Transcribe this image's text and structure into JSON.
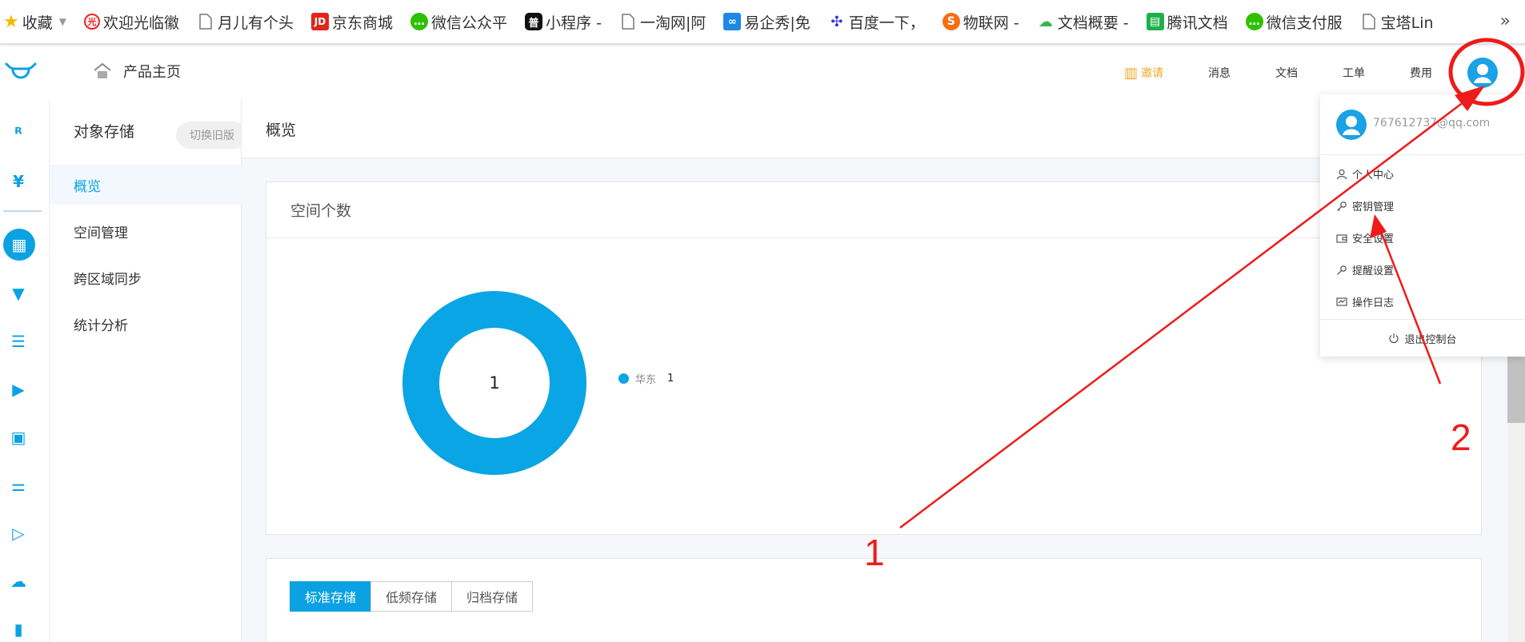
{
  "bookmarks": {
    "items": [
      {
        "label": "收藏",
        "icon": "star-icon"
      },
      {
        "label": "欢迎光临徽",
        "icon": "site-icon"
      },
      {
        "label": "月儿有个头",
        "icon": "page-icon"
      },
      {
        "label": "京东商城",
        "icon": "jd-icon"
      },
      {
        "label": "微信公众平",
        "icon": "wechat-icon"
      },
      {
        "label": "小程序 -",
        "icon": "miniprogram-icon"
      },
      {
        "label": "一淘网|阿",
        "icon": "page-icon"
      },
      {
        "label": "易企秀|免",
        "icon": "eqxiu-icon"
      },
      {
        "label": "百度一下，",
        "icon": "baidu-icon"
      },
      {
        "label": "物联网 -",
        "icon": "sohu-icon"
      },
      {
        "label": "文档概要 -",
        "icon": "cloud-icon"
      },
      {
        "label": "腾讯文档",
        "icon": "sheet-icon"
      },
      {
        "label": "微信支付服",
        "icon": "wechat-icon"
      },
      {
        "label": "宝塔Lin",
        "icon": "page-icon"
      }
    ],
    "more": "»"
  },
  "header": {
    "home_label": "产品主页",
    "nav": {
      "invite": "邀请",
      "messages": "消息",
      "docs": "文档",
      "tickets": "工单",
      "billing": "费用"
    }
  },
  "sidebar": {
    "title": "对象存储",
    "switch_old": "切换旧版",
    "items": [
      {
        "label": "概览",
        "active": true
      },
      {
        "label": "空间管理",
        "active": false
      },
      {
        "label": "跨区域同步",
        "active": false
      },
      {
        "label": "统计分析",
        "active": false
      }
    ]
  },
  "main": {
    "page_title": "概览",
    "space_card": {
      "title": "空间个数",
      "legend_name": "华东",
      "legend_value": "1"
    },
    "storage_tabs": [
      "标准存储",
      "低频存储",
      "归档存储"
    ]
  },
  "chart_data": {
    "type": "pie",
    "categories": [
      "华东"
    ],
    "values": [
      1
    ],
    "center_label": "1"
  },
  "user_menu": {
    "email": "767612737@qq.com",
    "items": [
      {
        "label": "个人中心",
        "icon": "user-icon"
      },
      {
        "label": "密钥管理",
        "icon": "key-icon"
      },
      {
        "label": "安全设置",
        "icon": "wallet-icon"
      },
      {
        "label": "提醒设置",
        "icon": "bell-icon"
      },
      {
        "label": "操作日志",
        "icon": "log-icon"
      }
    ],
    "logout": "退出控制台"
  },
  "annotations": {
    "label_1": "1",
    "label_2": "2",
    "color": "#ee1b1b"
  },
  "colors": {
    "accent": "#0ba1e2",
    "invite": "#f5a623"
  }
}
